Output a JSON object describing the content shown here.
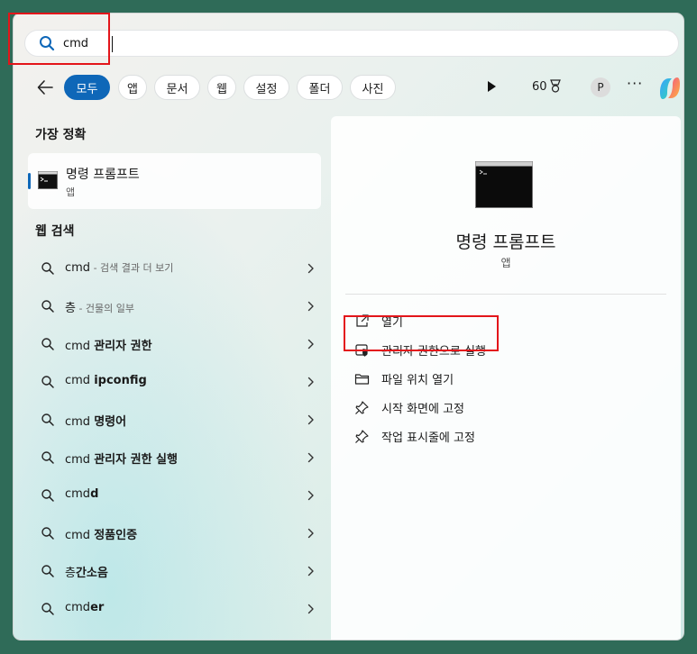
{
  "search": {
    "value": "cmd",
    "placeholder": ""
  },
  "filters": [
    "모두",
    "앱",
    "문서",
    "웹",
    "설정",
    "폴더",
    "사진"
  ],
  "toolbar": {
    "points": "60",
    "avatar": "P",
    "more": "···"
  },
  "best_match": {
    "title": "가장 정확",
    "name": "명령 프롬프트",
    "type": "앱"
  },
  "web_search": {
    "title": "웹 검색",
    "items": [
      {
        "prefix": "cmd",
        "bold": "",
        "sub": " - 검색 결과 더 보기"
      },
      {
        "prefix": "층",
        "bold": "",
        "sub": " - 건물의 일부"
      },
      {
        "prefix": "cmd ",
        "bold": "관리자 권한",
        "sub": ""
      },
      {
        "prefix": "cmd ",
        "bold": "ipconfig",
        "sub": ""
      },
      {
        "prefix": "cmd ",
        "bold": "명령어",
        "sub": ""
      },
      {
        "prefix": "cmd ",
        "bold": "관리자 권한 실행",
        "sub": ""
      },
      {
        "prefix": "cmd",
        "bold": "d",
        "sub": ""
      },
      {
        "prefix": "cmd ",
        "bold": "정품인증",
        "sub": ""
      },
      {
        "prefix": "층",
        "bold": "간소음",
        "sub": ""
      },
      {
        "prefix": "cmd",
        "bold": "er",
        "sub": ""
      }
    ]
  },
  "detail": {
    "name": "명령 프롬프트",
    "type": "앱",
    "actions": [
      "열기",
      "관리자 권한으로 실행",
      "파일 위치 열기",
      "시작 화면에 고정",
      "작업 표시줄에 고정"
    ]
  },
  "colors": {
    "accent": "#0e67b8",
    "highlight": "#e3151a"
  }
}
